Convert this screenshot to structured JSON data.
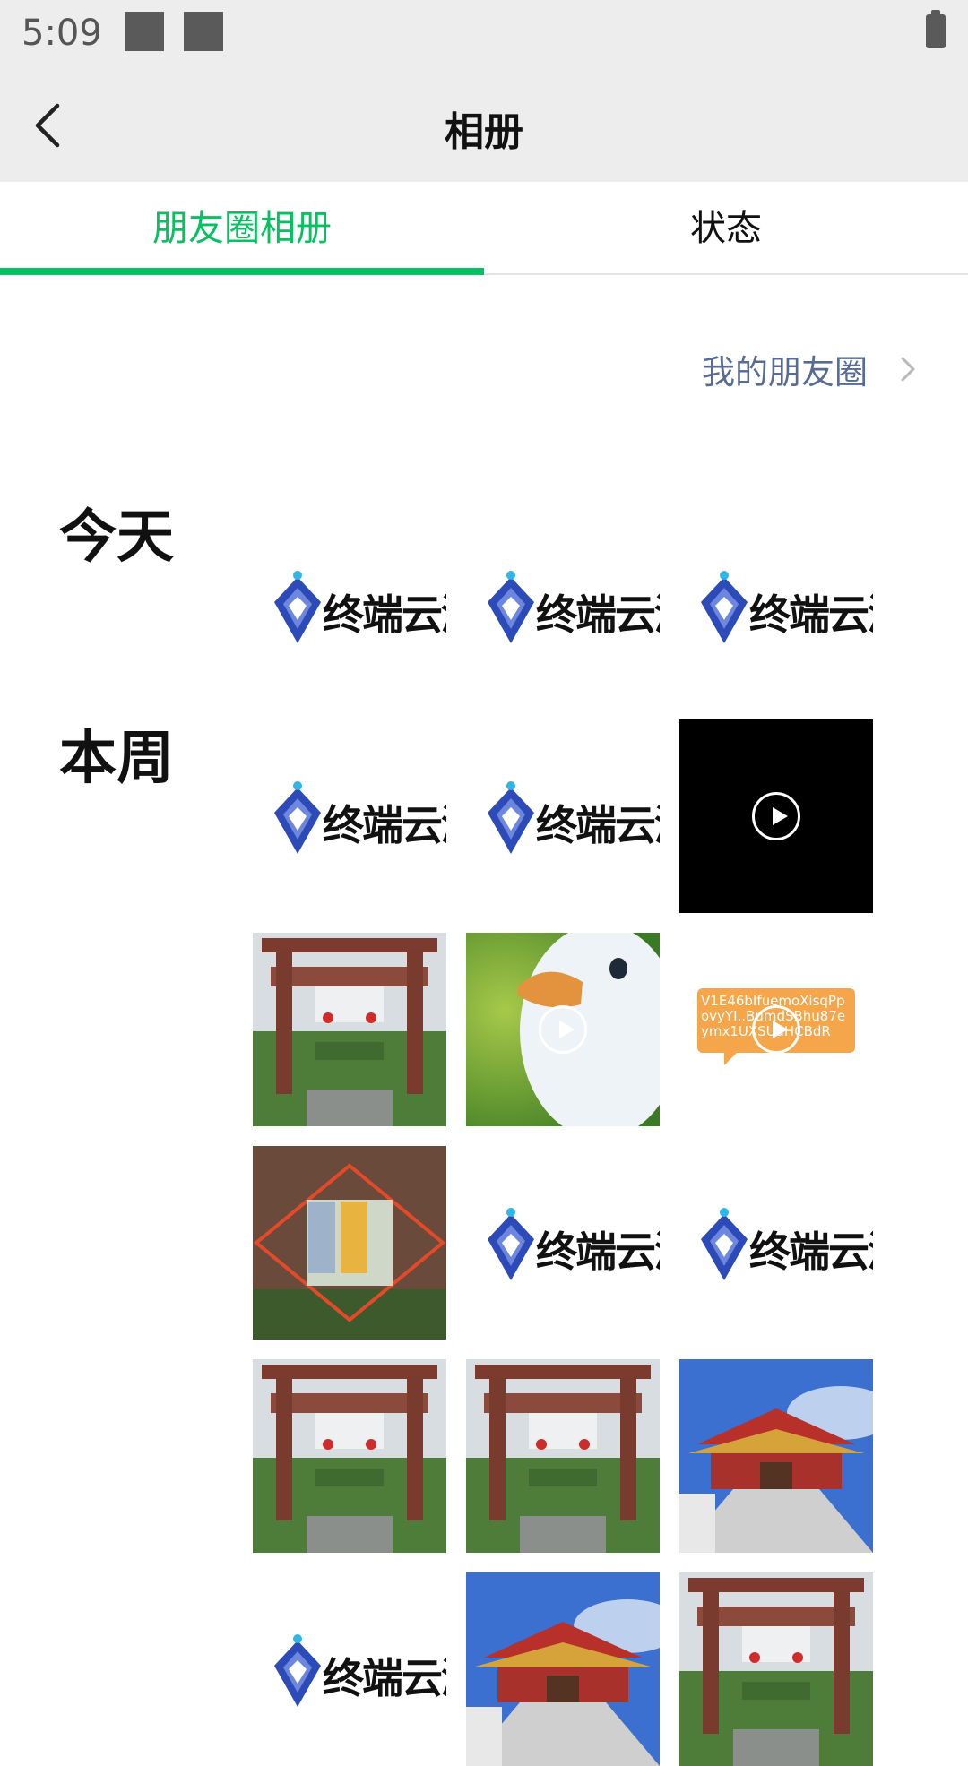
{
  "status_bar": {
    "time": "5:09",
    "notification_icons": [
      "app-notification-icon",
      "app-notification-icon"
    ],
    "battery_icon": "battery-icon"
  },
  "header": {
    "back_icon": "back-arrow-icon",
    "title": "相册"
  },
  "tabs": [
    {
      "label": "朋友圈相册",
      "selected": true
    },
    {
      "label": "状态",
      "selected": false
    }
  ],
  "my_moments_link": {
    "label": "我的朋友圈",
    "icon": "chevron-right-icon"
  },
  "sections": [
    {
      "label": "今天",
      "items": [
        {
          "type": "image",
          "content": "logo",
          "logo_text": "终端云测"
        },
        {
          "type": "image",
          "content": "logo",
          "logo_text": "终端云测"
        },
        {
          "type": "image",
          "content": "logo",
          "logo_text": "终端云测"
        }
      ]
    },
    {
      "label": "本周",
      "items": [
        {
          "type": "image",
          "content": "logo",
          "logo_text": "终端云测"
        },
        {
          "type": "image",
          "content": "logo",
          "logo_text": "终端云测"
        },
        {
          "type": "video",
          "content": "black-video"
        },
        {
          "type": "image",
          "content": "gate-photo"
        },
        {
          "type": "video",
          "content": "duck-video"
        },
        {
          "type": "video",
          "content": "text-note",
          "note_text": "V1E46bIfuemoXisqPpovyYI..BumdSBhu87eymx1UXSUaHCBdR"
        },
        {
          "type": "image",
          "content": "gate-collage"
        },
        {
          "type": "image",
          "content": "logo",
          "logo_text": "终端云测"
        },
        {
          "type": "image",
          "content": "logo",
          "logo_text": "终端云测"
        },
        {
          "type": "image",
          "content": "gate-photo"
        },
        {
          "type": "image",
          "content": "gate-photo"
        },
        {
          "type": "image",
          "content": "temple-photo"
        },
        {
          "type": "image",
          "content": "logo",
          "logo_text": "终端云测"
        },
        {
          "type": "image",
          "content": "temple-photo"
        },
        {
          "type": "image",
          "content": "gate-photo"
        }
      ]
    }
  ],
  "colors": {
    "accent": "#07c160",
    "link": "#576b95",
    "header_bg": "#ededed"
  }
}
